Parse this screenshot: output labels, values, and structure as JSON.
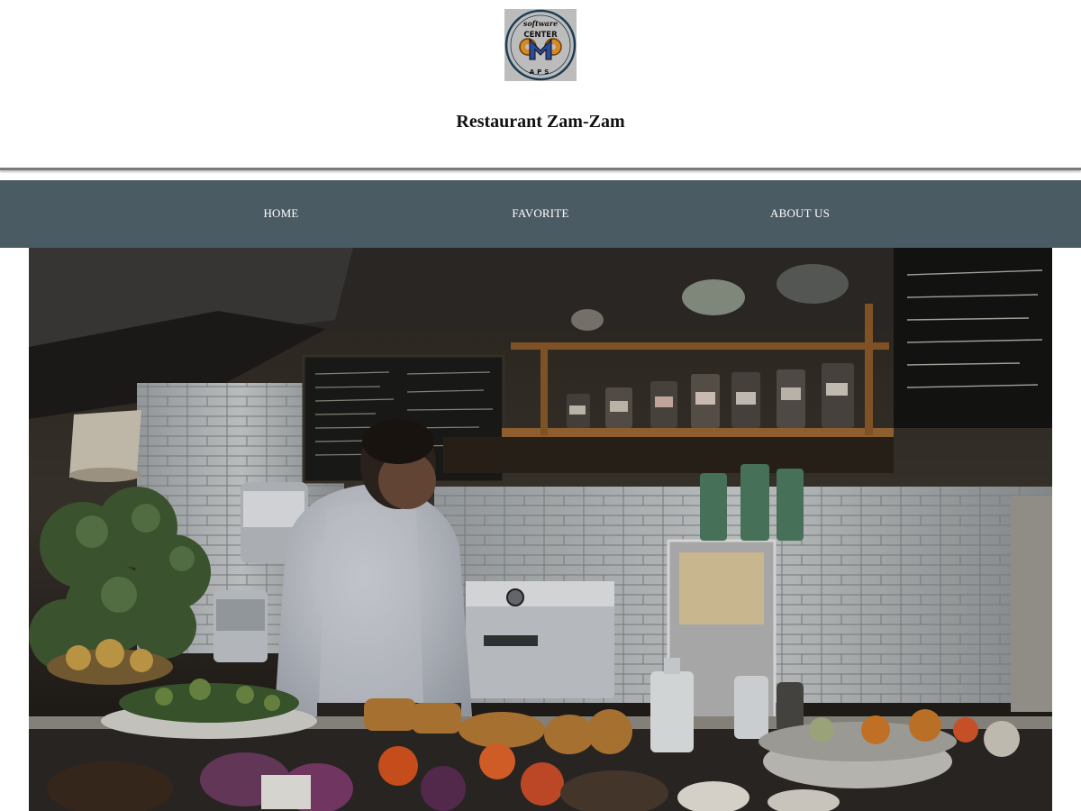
{
  "header": {
    "logo_text_top": "software",
    "logo_text_mid": "CENTER",
    "logo_text_bottom": "APS",
    "title": "Restaurant Zam-Zam"
  },
  "nav": {
    "items": [
      {
        "label": "HOME"
      },
      {
        "label": "FAVORITE"
      },
      {
        "label": "ABOUT US"
      }
    ]
  },
  "colors": {
    "nav_background": "#4b5b64",
    "nav_text": "#ffffff",
    "title_text": "#111111",
    "divider": "#7a7a7a"
  },
  "hero": {
    "icon": "restaurant-kitchen-photo"
  }
}
